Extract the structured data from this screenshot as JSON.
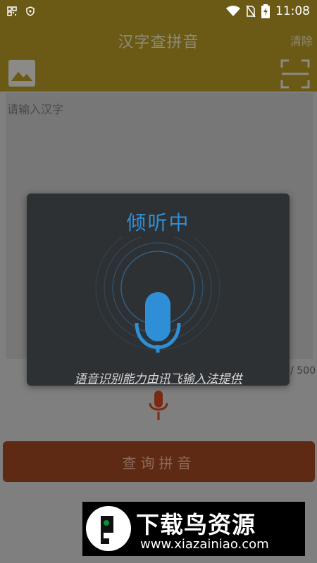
{
  "status_bar": {
    "time": "11:08"
  },
  "app_bar": {
    "title": "汉字查拼音",
    "clear_label": "清除"
  },
  "input": {
    "placeholder": "请输入汉字",
    "counter": "0 / 500"
  },
  "query_button": {
    "label": "查询拼音"
  },
  "voice_dialog": {
    "title": "倾听中",
    "provider_text": "语音识别能力由讯飞输入法提供"
  },
  "watermark": {
    "title": "下载鸟资源",
    "url": "www.xiazainiao.com"
  },
  "colors": {
    "app_bar": "#6b5a16",
    "dialog_bg": "#2e3134",
    "accent_blue": "#2f8fd6",
    "query_button": "#5e2a13",
    "mic_red": "#7a2a12"
  },
  "icons": [
    "qr-code-icon",
    "shield-icon",
    "wifi-icon",
    "no-sim-icon",
    "battery-charging-icon",
    "image-icon",
    "scan-icon",
    "microphone-icon",
    "bird-logo-icon"
  ]
}
